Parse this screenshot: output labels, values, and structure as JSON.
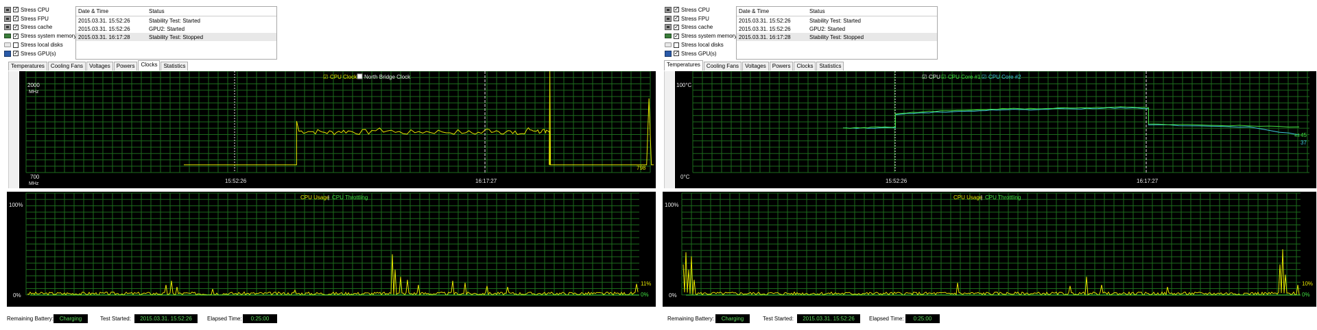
{
  "windows": [
    {
      "id": "left",
      "options": [
        {
          "icon": "cpu-icon",
          "label": "Stress CPU",
          "checked": true
        },
        {
          "icon": "fpu-icon",
          "label": "Stress FPU",
          "checked": true
        },
        {
          "icon": "cache-icon",
          "label": "Stress cache",
          "checked": true
        },
        {
          "icon": "memory-icon",
          "label": "Stress system memory",
          "checked": true
        },
        {
          "icon": "disk-icon",
          "label": "Stress local disks",
          "checked": false
        },
        {
          "icon": "gpu-icon",
          "label": "Stress GPU(s)",
          "checked": true
        }
      ],
      "log": {
        "headers": [
          "Date & Time",
          "Status"
        ],
        "rows": [
          [
            "2015.03.31. 15:52:26",
            "Stability Test: Started"
          ],
          [
            "2015.03.31. 15:52:26",
            "GPU2: Started"
          ],
          [
            "2015.03.31. 16:17:28",
            "Stability Test: Stopped"
          ]
        ]
      },
      "tabs": [
        "Temperatures",
        "Cooling Fans",
        "Voltages",
        "Powers",
        "Clocks",
        "Statistics"
      ],
      "active_tab": 4,
      "graph1": {
        "legend": [
          {
            "label": "CPU Clock",
            "checked": true,
            "color": "#e6e600"
          },
          {
            "label": "North Bridge Clock",
            "checked": false,
            "color": "#e8e8e8"
          }
        ],
        "ymax_label": "2000",
        "ymin_label": "700",
        "unit_label": "MHz",
        "time_labels": [
          "15:52:26",
          "16:17:27"
        ],
        "current_value": "798"
      },
      "graph2": {
        "legend": [
          "CPU Usage",
          "CPU Throttling"
        ],
        "separator": "|",
        "ymax_label": "100%",
        "ymin_label": "0%",
        "value_labels": [
          "11%",
          "0%"
        ]
      },
      "status": {
        "battery_label": "Remaining Battery:",
        "battery_value": "Charging",
        "started_label": "Test Started:",
        "started_value": "2015.03.31. 15:52:26",
        "elapsed_label": "Elapsed Time:",
        "elapsed_value": "0:25:00"
      }
    },
    {
      "id": "right",
      "options": [
        {
          "icon": "cpu-icon",
          "label": "Stress CPU",
          "checked": true
        },
        {
          "icon": "fpu-icon",
          "label": "Stress FPU",
          "checked": true
        },
        {
          "icon": "cache-icon",
          "label": "Stress cache",
          "checked": true
        },
        {
          "icon": "memory-icon",
          "label": "Stress system memory",
          "checked": true
        },
        {
          "icon": "disk-icon",
          "label": "Stress local disks",
          "checked": false
        },
        {
          "icon": "gpu-icon",
          "label": "Stress GPU(s)",
          "checked": true
        }
      ],
      "log": {
        "headers": [
          "Date & Time",
          "Status"
        ],
        "rows": [
          [
            "2015.03.31. 15:52:26",
            "Stability Test: Started"
          ],
          [
            "2015.03.31. 15:52:26",
            "GPU2: Started"
          ],
          [
            "2015.03.31. 16:17:28",
            "Stability Test: Stopped"
          ]
        ]
      },
      "tabs": [
        "Temperatures",
        "Cooling Fans",
        "Voltages",
        "Powers",
        "Clocks",
        "Statistics"
      ],
      "active_tab": 0,
      "graph1": {
        "legend": [
          {
            "label": "CPU",
            "checked": true,
            "color": "#e8e8e8"
          },
          {
            "label": "CPU Core #1",
            "checked": true,
            "color": "#40e040"
          },
          {
            "label": "CPU Core #2",
            "checked": true,
            "color": "#40c8e0"
          }
        ],
        "ymax_label": "100°C",
        "ymin_label": "0°C",
        "time_labels": [
          "15:52:26",
          "16:17:27"
        ],
        "current_values": [
          "45",
          "37"
        ],
        "current_prefix": "43"
      },
      "graph2": {
        "legend": [
          "CPU Usage",
          "CPU Throttling"
        ],
        "separator": "|",
        "ymax_label": "100%",
        "ymin_label": "0%",
        "value_labels": [
          "10%",
          "0%"
        ]
      },
      "status": {
        "battery_label": "Remaining Battery:",
        "battery_value": "Charging",
        "started_label": "Test Started:",
        "started_value": "2015.03.31. 15:52:26",
        "elapsed_label": "Elapsed Time:",
        "elapsed_value": "0:25:00"
      }
    }
  ],
  "colors": {
    "grid": "#1d6b1d",
    "cpu_clock": "#e6e600",
    "usage": "#e6e600",
    "throttling": "#40e040",
    "core1": "#40e040",
    "core2": "#40c8e0",
    "marker": "#e8e8e8"
  },
  "chart_data": [
    {
      "type": "line",
      "series": [
        {
          "name": "CPU Clock",
          "values_mhz": [
            798,
            798,
            1230,
            1225,
            1215,
            1230,
            1220,
            1240,
            1215,
            1225,
            1220,
            1210,
            1240,
            1225,
            1200,
            1250,
            1230,
            1210,
            1230,
            798,
            798,
            798,
            1650,
            798,
            798
          ],
          "x_fraction": [
            0,
            0.24,
            0.24,
            0.27,
            0.3,
            0.33,
            0.36,
            0.4,
            0.45,
            0.5,
            0.55,
            0.6,
            0.64,
            0.67,
            0.7,
            0.73,
            0.75,
            0.77,
            0.779,
            0.779,
            0.85,
            0.985,
            0.99,
            0.995,
            1
          ]
        }
      ],
      "ylim": [
        700,
        2000
      ]
    },
    {
      "type": "line",
      "series": [
        {
          "name": "CPU Core #1",
          "values": [
            44,
            44,
            45,
            45,
            58,
            60,
            61,
            62,
            63,
            63,
            64,
            64,
            65,
            64,
            48,
            47,
            46,
            45
          ]
        },
        {
          "name": "CPU Core #2",
          "values": [
            44,
            44,
            44,
            44,
            57,
            59,
            60,
            61,
            62,
            62,
            63,
            63,
            64,
            63,
            47,
            46,
            45,
            37
          ]
        }
      ],
      "ylim": [
        0,
        100
      ]
    }
  ]
}
